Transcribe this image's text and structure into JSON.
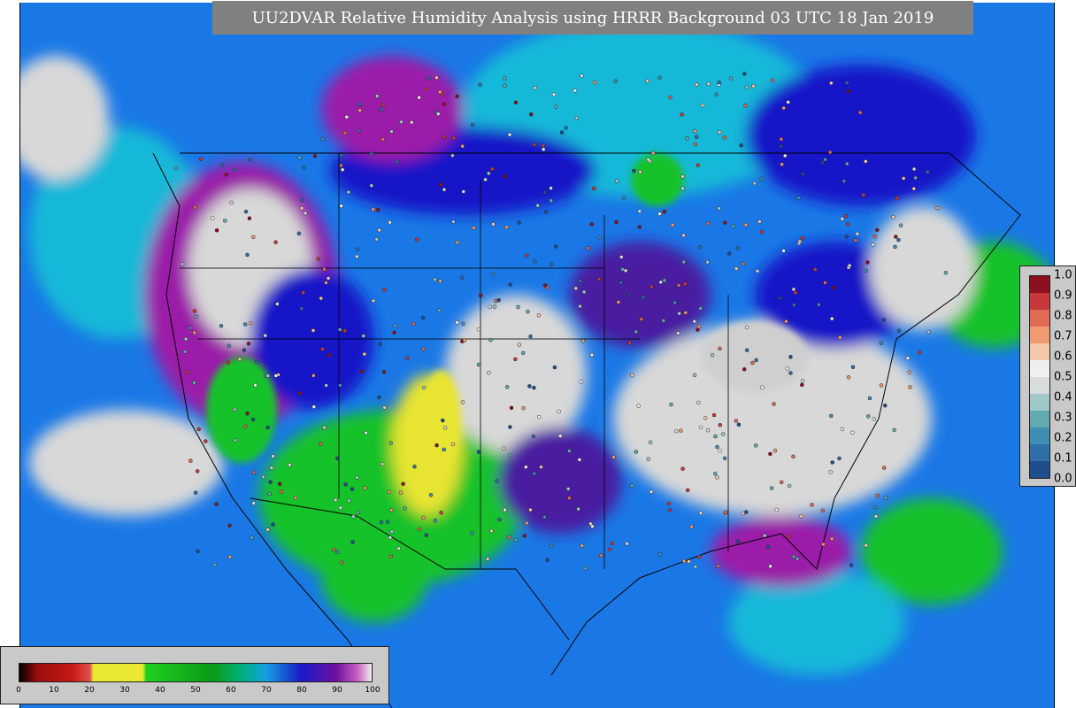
{
  "title": "UU2DVAR Relative Humidity Analysis using HRRR Background 03 UTC 18 Jan 2019",
  "map": {
    "background_colors": {
      "ocean_moist": "#1a78e6",
      "saturated": "#4a1aa0",
      "near_saturated": "#9b1ea8",
      "dry_white": "#d8d8d8",
      "mid_green": "#19c22a",
      "dry_yellow": "#e8e430",
      "mid_cyan": "#16b8d8",
      "deep_blue": "#1515c8"
    }
  },
  "observation_legend": {
    "ticks": [
      "1.0",
      "0.9",
      "0.8",
      "0.7",
      "0.6",
      "0.5",
      "0.4",
      "0.3",
      "0.2",
      "0.1",
      "0.0"
    ],
    "colors": [
      "#1f4e8c",
      "#2e6fa8",
      "#3f8fb4",
      "#62aab0",
      "#a0c8c8",
      "#d8dcdc",
      "#f0eeee",
      "#f3c8a8",
      "#f09a70",
      "#e06a52",
      "#c8383a",
      "#8c1020"
    ]
  },
  "rh_legend": {
    "ticks": [
      "0",
      "10",
      "20",
      "30",
      "40",
      "50",
      "60",
      "70",
      "80",
      "90",
      "100"
    ],
    "stops": [
      {
        "v": 0,
        "c": "#000000"
      },
      {
        "v": 5,
        "c": "#9a0d0d"
      },
      {
        "v": 15,
        "c": "#c81818"
      },
      {
        "v": 20,
        "c": "#e05050"
      },
      {
        "v": 21,
        "c": "#e8e830"
      },
      {
        "v": 35,
        "c": "#e8e830"
      },
      {
        "v": 36,
        "c": "#20d020"
      },
      {
        "v": 55,
        "c": "#0a9a18"
      },
      {
        "v": 62,
        "c": "#00b070"
      },
      {
        "v": 70,
        "c": "#14a0e0"
      },
      {
        "v": 80,
        "c": "#1a1ac8"
      },
      {
        "v": 90,
        "c": "#7010a0"
      },
      {
        "v": 96,
        "c": "#c860c0"
      },
      {
        "v": 100,
        "c": "#f0f0f0"
      }
    ]
  }
}
